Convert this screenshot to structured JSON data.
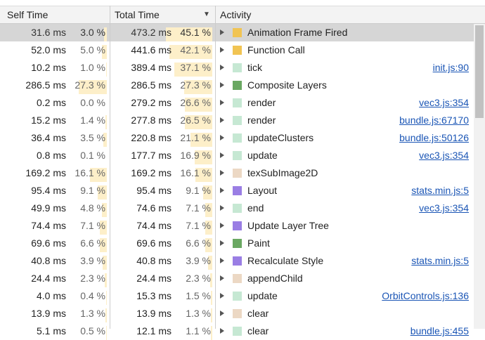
{
  "header": {
    "self_time": "Self Time",
    "total_time": "Total Time",
    "activity": "Activity",
    "sort_arrow": "▼"
  },
  "colors": {
    "orange": "#f1c453",
    "light_green": "#c6e8d3",
    "green": "#6aa862",
    "purple": "#9a7ee4",
    "beige": "#ecd8c4",
    "bar": "#fdefc9",
    "link": "#1a55b5"
  },
  "rows": [
    {
      "self_ms": "31.6 ms",
      "self_pct": "3.0 %",
      "self_frac": 0.03,
      "total_ms": "473.2 ms",
      "total_pct": "45.1 %",
      "total_frac": 0.451,
      "name": "Animation Frame Fired",
      "color": "orange",
      "link": "",
      "selected": true
    },
    {
      "self_ms": "52.0 ms",
      "self_pct": "5.0 %",
      "self_frac": 0.05,
      "total_ms": "441.6 ms",
      "total_pct": "42.1 %",
      "total_frac": 0.421,
      "name": "Function Call",
      "color": "orange",
      "link": ""
    },
    {
      "self_ms": "10.2 ms",
      "self_pct": "1.0 %",
      "self_frac": 0.01,
      "total_ms": "389.4 ms",
      "total_pct": "37.1 %",
      "total_frac": 0.371,
      "name": "tick",
      "color": "light_green",
      "link": "init.js:90"
    },
    {
      "self_ms": "286.5 ms",
      "self_pct": "27.3 %",
      "self_frac": 0.273,
      "total_ms": "286.5 ms",
      "total_pct": "27.3 %",
      "total_frac": 0.273,
      "name": "Composite Layers",
      "color": "green",
      "link": ""
    },
    {
      "self_ms": "0.2 ms",
      "self_pct": "0.0 %",
      "self_frac": 0.0,
      "total_ms": "279.2 ms",
      "total_pct": "26.6 %",
      "total_frac": 0.266,
      "name": "render",
      "color": "light_green",
      "link": "vec3.js:354"
    },
    {
      "self_ms": "15.2 ms",
      "self_pct": "1.4 %",
      "self_frac": 0.014,
      "total_ms": "277.8 ms",
      "total_pct": "26.5 %",
      "total_frac": 0.265,
      "name": "render",
      "color": "light_green",
      "link": "bundle.js:67170"
    },
    {
      "self_ms": "36.4 ms",
      "self_pct": "3.5 %",
      "self_frac": 0.035,
      "total_ms": "220.8 ms",
      "total_pct": "21.1 %",
      "total_frac": 0.211,
      "name": "updateClusters",
      "color": "light_green",
      "link": "bundle.js:50126"
    },
    {
      "self_ms": "0.8 ms",
      "self_pct": "0.1 %",
      "self_frac": 0.001,
      "total_ms": "177.7 ms",
      "total_pct": "16.9 %",
      "total_frac": 0.169,
      "name": "update",
      "color": "light_green",
      "link": "vec3.js:354"
    },
    {
      "self_ms": "169.2 ms",
      "self_pct": "16.1 %",
      "self_frac": 0.161,
      "total_ms": "169.2 ms",
      "total_pct": "16.1 %",
      "total_frac": 0.161,
      "name": "texSubImage2D",
      "color": "beige",
      "link": ""
    },
    {
      "self_ms": "95.4 ms",
      "self_pct": "9.1 %",
      "self_frac": 0.091,
      "total_ms": "95.4 ms",
      "total_pct": "9.1 %",
      "total_frac": 0.091,
      "name": "Layout",
      "color": "purple",
      "link": "stats.min.js:5"
    },
    {
      "self_ms": "49.9 ms",
      "self_pct": "4.8 %",
      "self_frac": 0.048,
      "total_ms": "74.6 ms",
      "total_pct": "7.1 %",
      "total_frac": 0.071,
      "name": "end",
      "color": "light_green",
      "link": "vec3.js:354"
    },
    {
      "self_ms": "74.4 ms",
      "self_pct": "7.1 %",
      "self_frac": 0.071,
      "total_ms": "74.4 ms",
      "total_pct": "7.1 %",
      "total_frac": 0.071,
      "name": "Update Layer Tree",
      "color": "purple",
      "link": ""
    },
    {
      "self_ms": "69.6 ms",
      "self_pct": "6.6 %",
      "self_frac": 0.066,
      "total_ms": "69.6 ms",
      "total_pct": "6.6 %",
      "total_frac": 0.066,
      "name": "Paint",
      "color": "green",
      "link": ""
    },
    {
      "self_ms": "40.8 ms",
      "self_pct": "3.9 %",
      "self_frac": 0.039,
      "total_ms": "40.8 ms",
      "total_pct": "3.9 %",
      "total_frac": 0.039,
      "name": "Recalculate Style",
      "color": "purple",
      "link": "stats.min.js:5"
    },
    {
      "self_ms": "24.4 ms",
      "self_pct": "2.3 %",
      "self_frac": 0.023,
      "total_ms": "24.4 ms",
      "total_pct": "2.3 %",
      "total_frac": 0.023,
      "name": "appendChild",
      "color": "beige",
      "link": ""
    },
    {
      "self_ms": "4.0 ms",
      "self_pct": "0.4 %",
      "self_frac": 0.004,
      "total_ms": "15.3 ms",
      "total_pct": "1.5 %",
      "total_frac": 0.015,
      "name": "update",
      "color": "light_green",
      "link": "OrbitControls.js:136"
    },
    {
      "self_ms": "13.9 ms",
      "self_pct": "1.3 %",
      "self_frac": 0.013,
      "total_ms": "13.9 ms",
      "total_pct": "1.3 %",
      "total_frac": 0.013,
      "name": "clear",
      "color": "beige",
      "link": ""
    },
    {
      "self_ms": "5.1 ms",
      "self_pct": "0.5 %",
      "self_frac": 0.005,
      "total_ms": "12.1 ms",
      "total_pct": "1.1 %",
      "total_frac": 0.011,
      "name": "clear",
      "color": "light_green",
      "link": "bundle.js:455"
    }
  ]
}
